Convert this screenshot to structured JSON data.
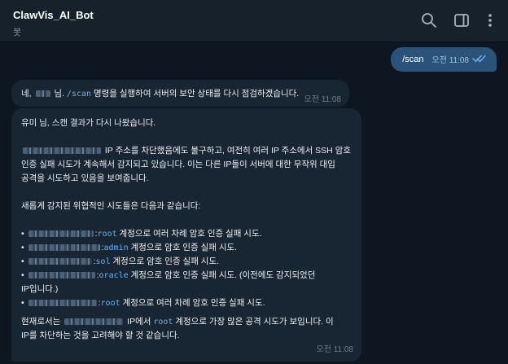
{
  "header": {
    "title": "ClawVis_AI_Bot",
    "subtitle": "봇",
    "icons": [
      "search-icon",
      "sidebar-toggle-icon",
      "more-vertical-icon"
    ]
  },
  "messages": {
    "outgoing": {
      "text": "/scan",
      "time": "오전 11:08",
      "status": "read"
    },
    "reply1": {
      "prefix": "네,",
      "name_suffix": "님.",
      "command": "/scan",
      "rest": "명령을 실행하여 서버의 보안 상태를 다시 점검하겠습니다.",
      "time": "오전 11:08"
    },
    "reply2": {
      "greeting": "유미 님, 스캔 결과가 다시 나왔습니다.",
      "para1_line1": "IP 주소를 차단했음에도 불구하고, 여전히 여러 IP 주소에서 SSH 암호",
      "para1_line2": "인증 실패 시도가 계속해서 감지되고 있습니다. 이는 다른 IP들이 서버에 대한 무작위 대입",
      "para1_line3": "공격을 시도하고 있음을 보여줍니다.",
      "para2": "새롭게 감지된 위협적인 시도들은 다음과 같습니다:",
      "bullets": [
        {
          "bullet": "•",
          "sep": ":",
          "user": "root",
          "text": "계정으로 여러 차례 암호 인증 실패 시도."
        },
        {
          "bullet": "•",
          "sep": ":",
          "user": "admin",
          "text": "계정으로 암호 인증 실패 시도."
        },
        {
          "bullet": "•",
          "sep": ":",
          "user": "sol",
          "text": "계정으로 암호 인증 실패 시도."
        },
        {
          "bullet": "•",
          "sep": ":",
          "user": "oracle",
          "text": "계정으로 암호 인증 실패 시도. (이전에도 감지되었던",
          "cont": "IP입니다.)"
        },
        {
          "bullet": "•",
          "sep": ":",
          "user": "root",
          "text": "계정으로 여러 차례 암호 인증 실패 시도."
        }
      ],
      "conclusion_a": "현재로서는",
      "conclusion_b": "IP에서",
      "conclusion_user": "root",
      "conclusion_c": "계정으로 가장 많은 공격 시도가 보입니다. 이",
      "conclusion_line2": "IP를 차단하는 것을 고려해야 할 것 같습니다.",
      "time": "오전 11:08"
    }
  },
  "colors": {
    "background": "#0e1621",
    "header": "#17212b",
    "outgoing_bubble": "#2b5278",
    "incoming_bubble": "#182533",
    "link": "#6ab2f2"
  }
}
